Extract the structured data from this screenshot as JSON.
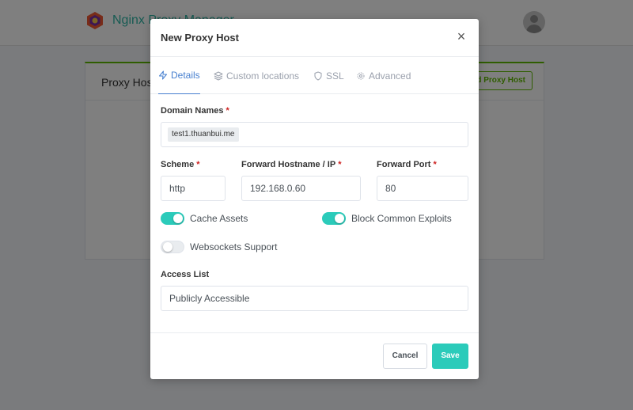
{
  "app": {
    "brand_name": "Nginx Proxy Manager"
  },
  "background": {
    "card_title": "Proxy Hosts",
    "add_button": "Add Proxy Host"
  },
  "modal": {
    "title": "New Proxy Host",
    "close_label": "×",
    "tabs": [
      {
        "label": "Details",
        "icon": "zap-icon",
        "active": true
      },
      {
        "label": "Custom locations",
        "icon": "layers-icon",
        "active": false
      },
      {
        "label": "SSL",
        "icon": "shield-icon",
        "active": false
      },
      {
        "label": "Advanced",
        "icon": "settings-icon",
        "active": false
      }
    ],
    "domain_names": {
      "label": "Domain Names",
      "required_mark": "*",
      "tags": [
        "test1.thuanbui.me"
      ]
    },
    "scheme": {
      "label": "Scheme",
      "required_mark": "*",
      "value": "http"
    },
    "forward_host": {
      "label": "Forward Hostname / IP",
      "required_mark": "*",
      "value": "192.168.0.60"
    },
    "forward_port": {
      "label": "Forward Port",
      "required_mark": "*",
      "value": "80"
    },
    "toggles": {
      "cache_assets": {
        "label": "Cache Assets",
        "on": true
      },
      "block_exploits": {
        "label": "Block Common Exploits",
        "on": true
      },
      "websockets": {
        "label": "Websockets Support",
        "on": false
      }
    },
    "access_list": {
      "label": "Access List",
      "value": "Publicly Accessible"
    },
    "footer": {
      "cancel_label": "Cancel",
      "save_label": "Save"
    }
  },
  "colors": {
    "accent_teal": "#2bcbba",
    "tab_active_blue": "#467fcf",
    "brand_green": "#5eba00",
    "required_red": "#cd201f"
  }
}
